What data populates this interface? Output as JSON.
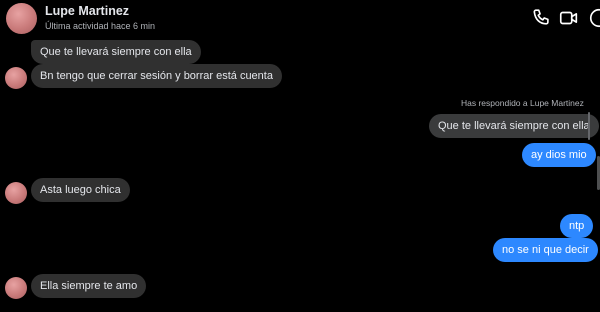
{
  "header": {
    "contact_name": "Lupe Martinez",
    "status": "Última actividad hace 6 min",
    "icons": [
      "phone-icon",
      "video-camera-icon",
      "info-icon"
    ]
  },
  "messages": [
    {
      "direction": "incoming",
      "text": "Que te llevará siempre con ella"
    },
    {
      "direction": "incoming",
      "text": "Bn tengo que cerrar sesión y borrar está cuenta"
    },
    {
      "direction": "outgoing",
      "reply_label": "Has respondido a Lupe Martinez",
      "quoted_text": "Que te llevará siempre con ella",
      "text": "ay dios mio"
    },
    {
      "direction": "incoming",
      "text": "Asta luego chica"
    },
    {
      "direction": "outgoing",
      "text": "ntp"
    },
    {
      "direction": "outgoing",
      "text": "no se ni que decir"
    },
    {
      "direction": "incoming",
      "text": "Ella siempre te amo"
    }
  ],
  "colors": {
    "background": "#000000",
    "incoming_bubble": "#303030",
    "outgoing_bubble": "#2d88ff",
    "accent_icons": "#ffffff"
  }
}
